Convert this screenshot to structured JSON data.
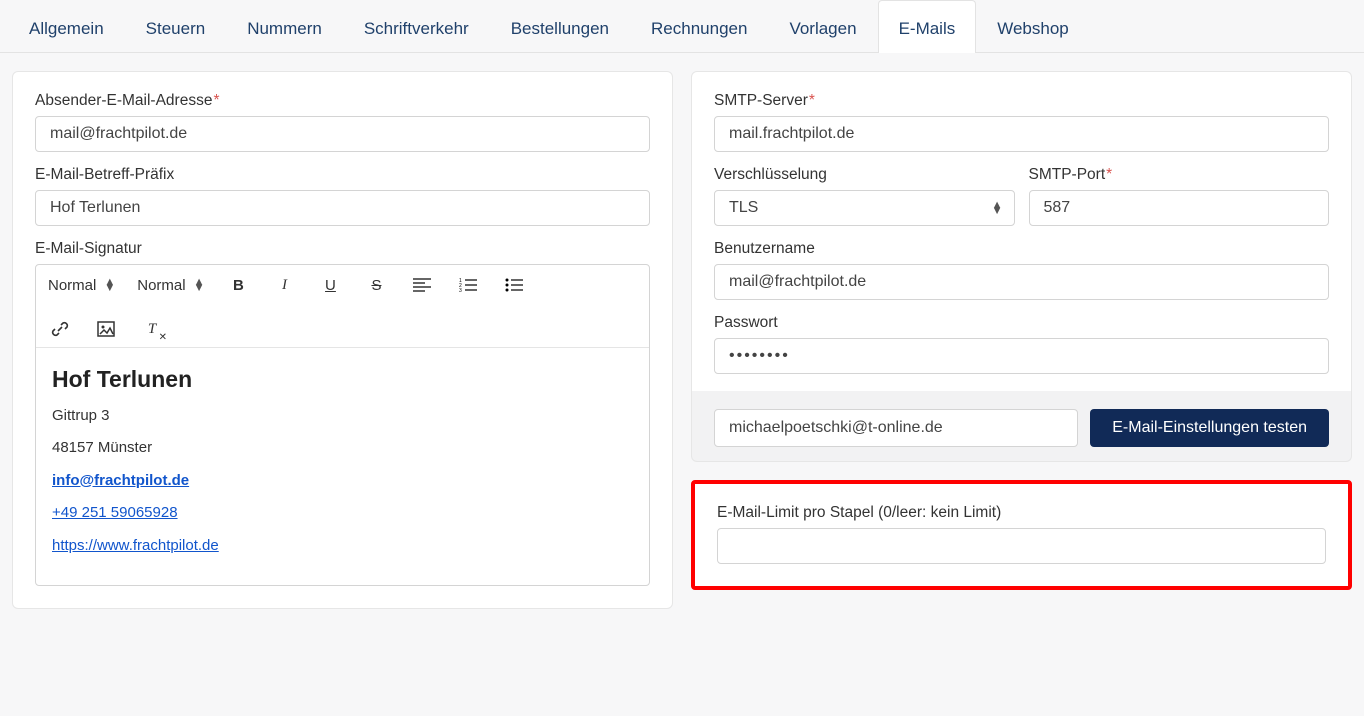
{
  "tabs": [
    {
      "label": "Allgemein",
      "active": false
    },
    {
      "label": "Steuern",
      "active": false
    },
    {
      "label": "Nummern",
      "active": false
    },
    {
      "label": "Schriftverkehr",
      "active": false
    },
    {
      "label": "Bestellungen",
      "active": false
    },
    {
      "label": "Rechnungen",
      "active": false
    },
    {
      "label": "Vorlagen",
      "active": false
    },
    {
      "label": "E-Mails",
      "active": true
    },
    {
      "label": "Webshop",
      "active": false
    }
  ],
  "left": {
    "sender_label": "Absender-E-Mail-Adresse",
    "sender_value": "mail@frachtpilot.de",
    "prefix_label": "E-Mail-Betreff-Präfix",
    "prefix_value": "Hof Terlunen",
    "signature_label": "E-Mail-Signatur",
    "rte": {
      "style1": "Normal",
      "style2": "Normal"
    },
    "signature": {
      "heading": "Hof Terlunen",
      "line1": "Gittrup 3",
      "line2": "48157 Münster",
      "email": "info@frachtpilot.de",
      "phone": "+49 251 59065928",
      "url": "https://www.frachtpilot.de"
    }
  },
  "right": {
    "server_label": "SMTP-Server",
    "server_value": "mail.frachtpilot.de",
    "enc_label": "Verschlüsselung",
    "enc_value": "TLS",
    "port_label": "SMTP-Port",
    "port_value": "587",
    "user_label": "Benutzername",
    "user_value": "mail@frachtpilot.de",
    "pass_label": "Passwort",
    "pass_value": "••••••••",
    "test_email": "michaelpoetschki@t-online.de",
    "test_button": "E-Mail-Einstellungen testen",
    "limit_label": "E-Mail-Limit pro Stapel (0/leer: kein Limit)",
    "limit_value": ""
  }
}
